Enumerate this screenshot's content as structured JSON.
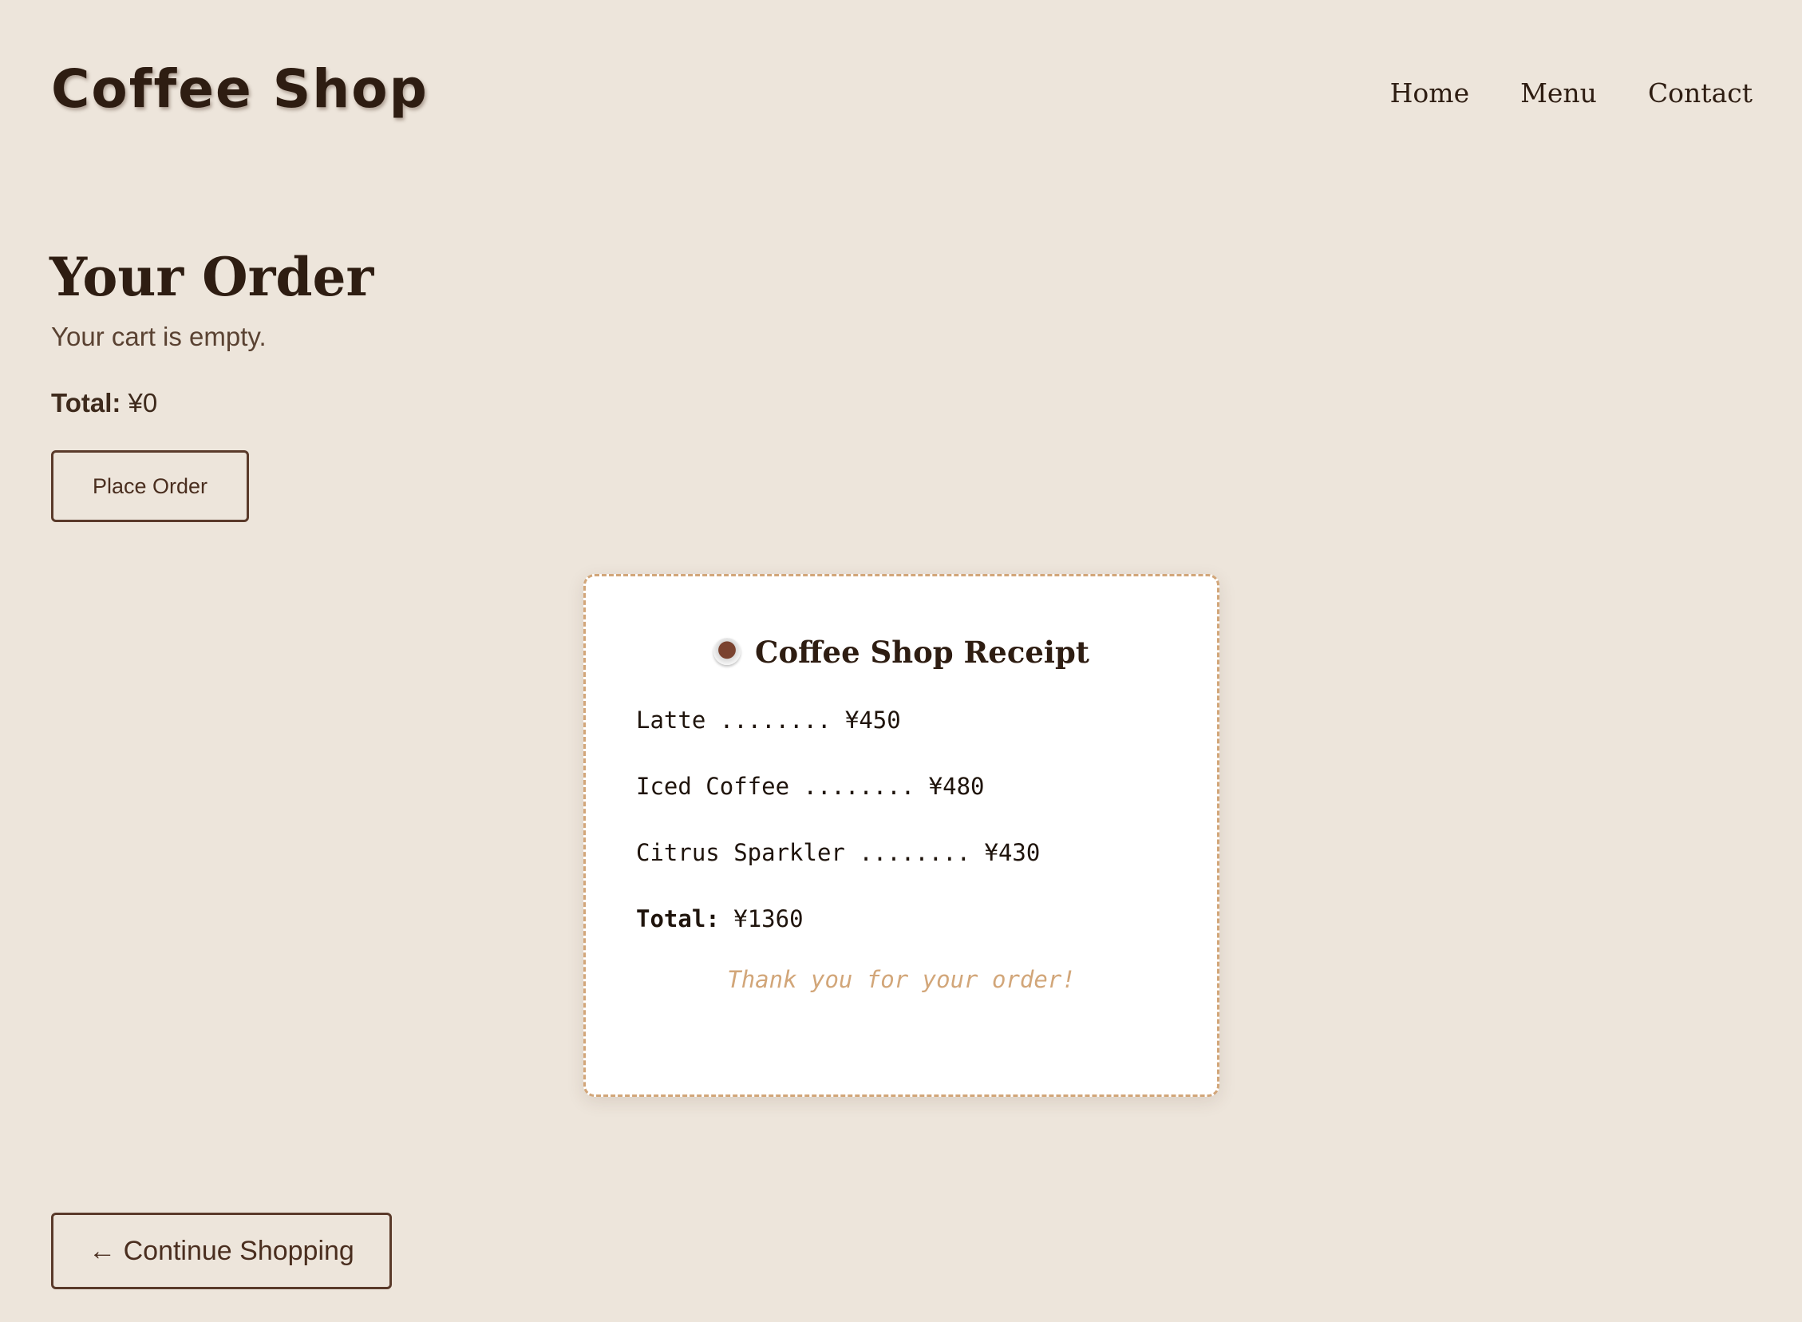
{
  "header": {
    "logo": "Coffee Shop",
    "nav": [
      "Home",
      "Menu",
      "Contact"
    ]
  },
  "order": {
    "title": "Your Order",
    "empty_message": "Your cart is empty.",
    "total_label": "Total:",
    "total_value": "¥0",
    "place_order_label": "Place Order"
  },
  "receipt": {
    "icon": "coffee-cup-icon",
    "title": "Coffee Shop Receipt",
    "items": [
      "Latte ........ ¥450",
      "Iced Coffee ........ ¥480",
      "Citrus Sparkler ........ ¥430"
    ],
    "total_label": "Total:",
    "total_value": "¥1360",
    "thanks": "Thank you for your order!"
  },
  "footer": {
    "continue_label": "← Continue Shopping"
  },
  "colors": {
    "background": "#ede5db",
    "text_dark": "#2e1d12",
    "accent": "#d2a679",
    "button_border": "#5a3a2a"
  }
}
